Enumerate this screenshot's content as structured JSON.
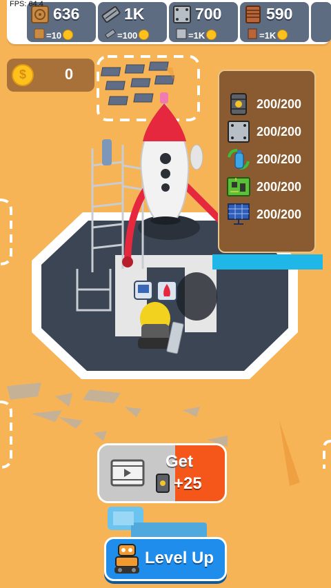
{
  "fps": "FPS: 64.4",
  "resources": [
    {
      "icon": "wood-log-icon",
      "count": "636",
      "cost": "=10"
    },
    {
      "icon": "steel-beam-icon",
      "count": "1K",
      "cost": "=100"
    },
    {
      "icon": "metal-plate-icon",
      "count": "700",
      "cost": "=1K"
    },
    {
      "icon": "copper-coil-icon",
      "count": "590",
      "cost": "=1K"
    }
  ],
  "coins": "0",
  "requirements": [
    {
      "icon": "fuel-barrel-icon",
      "value": "200/200"
    },
    {
      "icon": "metal-plate-icon",
      "value": "200/200"
    },
    {
      "icon": "water-bottle-icon",
      "value": "200/200"
    },
    {
      "icon": "circuit-board-icon",
      "value": "200/200"
    },
    {
      "icon": "solar-panel-icon",
      "value": "200/200"
    }
  ],
  "get_button": {
    "line1": "Get",
    "line2": "+25",
    "video_icon": "video-icon",
    "barrel_icon": "fuel-barrel-icon"
  },
  "level_button": {
    "label": "Level Up",
    "icon": "robot-icon"
  },
  "colors": {
    "ground": "#F6B457",
    "platform": "#3C4553",
    "rocket_red": "#E5283D",
    "progress": "#1FB6E8"
  }
}
